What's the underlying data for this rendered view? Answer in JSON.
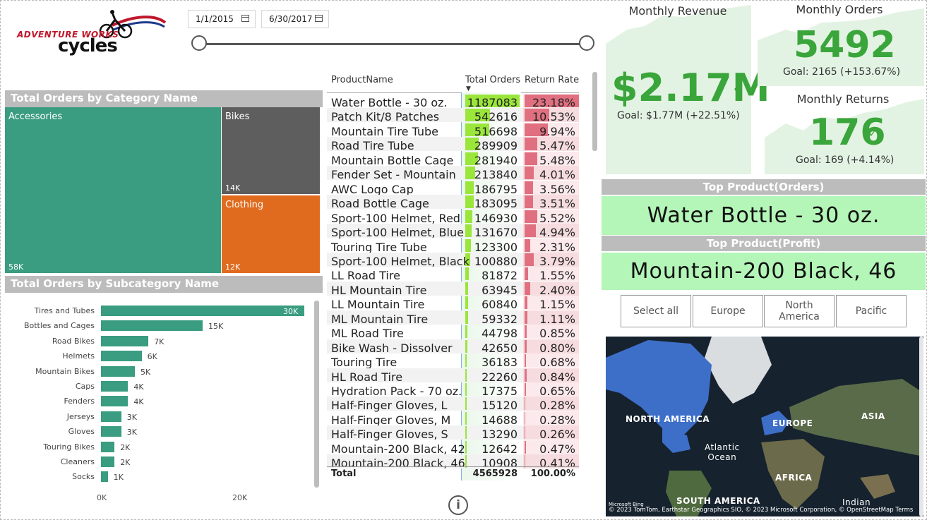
{
  "logo": {
    "line1": "ADVENTURE WORKS",
    "line2": "cycles"
  },
  "date_slicer": {
    "start": "1/1/2015",
    "end": "6/30/2017"
  },
  "category_treemap": {
    "title": "Total Orders by Category Name",
    "tiles": [
      {
        "name": "Accessories",
        "value": "58K",
        "color": "#3a9c80"
      },
      {
        "name": "Bikes",
        "value": "14K",
        "color": "#5e5e5e"
      },
      {
        "name": "Clothing",
        "value": "12K",
        "color": "#e06b1e"
      }
    ]
  },
  "chart_data": {
    "type": "bar",
    "title": "Total Orders by Subcategory Name",
    "categories": [
      "Tires and Tubes",
      "Bottles and Cages",
      "Road Bikes",
      "Helmets",
      "Mountain Bikes",
      "Caps",
      "Fenders",
      "Jerseys",
      "Gloves",
      "Touring Bikes",
      "Cleaners",
      "Socks"
    ],
    "values": [
      30000,
      15000,
      7000,
      6000,
      5000,
      4000,
      4000,
      3000,
      3000,
      2000,
      2000,
      1000
    ],
    "value_labels": [
      "30K",
      "15K",
      "7K",
      "6K",
      "5K",
      "4K",
      "4K",
      "3K",
      "3K",
      "2K",
      "2K",
      "1K"
    ],
    "x_ticks": [
      "0K",
      "20K"
    ],
    "xlim": [
      0,
      30000
    ],
    "color": "#3a9c80"
  },
  "product_table": {
    "headers": {
      "name": "ProductName",
      "orders": "Total Orders",
      "returns": "Return Rate"
    },
    "rows": [
      {
        "name": "Water Bottle - 30 oz.",
        "orders": "1187083",
        "rate": "23.18%",
        "o": 1187083,
        "r": 23.18
      },
      {
        "name": "Patch Kit/8 Patches",
        "orders": "542616",
        "rate": "10.53%",
        "o": 542616,
        "r": 10.53
      },
      {
        "name": "Mountain Tire Tube",
        "orders": "516698",
        "rate": "9.94%",
        "o": 516698,
        "r": 9.94
      },
      {
        "name": "Road Tire Tube",
        "orders": "289909",
        "rate": "5.47%",
        "o": 289909,
        "r": 5.47
      },
      {
        "name": "Mountain Bottle Cage",
        "orders": "281940",
        "rate": "5.48%",
        "o": 281940,
        "r": 5.48
      },
      {
        "name": "Fender Set - Mountain",
        "orders": "213840",
        "rate": "4.01%",
        "o": 213840,
        "r": 4.01
      },
      {
        "name": "AWC Logo Cap",
        "orders": "186795",
        "rate": "3.56%",
        "o": 186795,
        "r": 3.56
      },
      {
        "name": "Road Bottle Cage",
        "orders": "183095",
        "rate": "3.51%",
        "o": 183095,
        "r": 3.51
      },
      {
        "name": "Sport-100 Helmet, Red",
        "orders": "146930",
        "rate": "5.52%",
        "o": 146930,
        "r": 5.52
      },
      {
        "name": "Sport-100 Helmet, Blue",
        "orders": "131670",
        "rate": "4.94%",
        "o": 131670,
        "r": 4.94
      },
      {
        "name": "Touring Tire Tube",
        "orders": "123300",
        "rate": "2.31%",
        "o": 123300,
        "r": 2.31
      },
      {
        "name": "Sport-100 Helmet, Black",
        "orders": "100880",
        "rate": "3.79%",
        "o": 100880,
        "r": 3.79
      },
      {
        "name": "LL Road Tire",
        "orders": "81872",
        "rate": "1.55%",
        "o": 81872,
        "r": 1.55
      },
      {
        "name": "HL Mountain Tire",
        "orders": "63945",
        "rate": "2.40%",
        "o": 63945,
        "r": 2.4
      },
      {
        "name": "LL Mountain Tire",
        "orders": "60840",
        "rate": "1.15%",
        "o": 60840,
        "r": 1.15
      },
      {
        "name": "ML Mountain Tire",
        "orders": "59332",
        "rate": "1.11%",
        "o": 59332,
        "r": 1.11
      },
      {
        "name": "ML Road Tire",
        "orders": "44798",
        "rate": "0.85%",
        "o": 44798,
        "r": 0.85
      },
      {
        "name": "Bike Wash - Dissolver",
        "orders": "42650",
        "rate": "0.80%",
        "o": 42650,
        "r": 0.8
      },
      {
        "name": "Touring Tire",
        "orders": "36183",
        "rate": "0.68%",
        "o": 36183,
        "r": 0.68
      },
      {
        "name": "HL Road Tire",
        "orders": "22260",
        "rate": "0.84%",
        "o": 22260,
        "r": 0.84
      },
      {
        "name": "Hydration Pack - 70 oz.",
        "orders": "17375",
        "rate": "0.65%",
        "o": 17375,
        "r": 0.65
      },
      {
        "name": "Half-Finger Gloves, L",
        "orders": "15120",
        "rate": "0.28%",
        "o": 15120,
        "r": 0.28
      },
      {
        "name": "Half-Finger Gloves, M",
        "orders": "14688",
        "rate": "0.28%",
        "o": 14688,
        "r": 0.28
      },
      {
        "name": "Half-Finger Gloves, S",
        "orders": "13290",
        "rate": "0.26%",
        "o": 13290,
        "r": 0.26
      },
      {
        "name": "Mountain-200 Black, 42",
        "orders": "12642",
        "rate": "0.47%",
        "o": 12642,
        "r": 0.47
      },
      {
        "name": "Mountain-200 Black, 46",
        "orders": "10908",
        "rate": "0.41%",
        "o": 10908,
        "r": 0.41
      }
    ],
    "total": {
      "label": "Total",
      "orders": "4565928",
      "rate": "100.00%"
    }
  },
  "kpis": {
    "revenue": {
      "title": "Monthly Revenue",
      "value": "$2.17M",
      "goal": "Goal: $1.77M (+22.51%)"
    },
    "orders": {
      "title": "Monthly Orders",
      "value": "5492",
      "goal": "Goal: 2165 (+153.67%)"
    },
    "returns": {
      "title": "Monthly Returns",
      "value": "176",
      "goal": "Goal: 169 (+4.14%)"
    },
    "check_mark": "✓"
  },
  "top_product_orders": {
    "title": "Top Product(Orders)",
    "value": "Water Bottle - 30 oz."
  },
  "top_product_profit": {
    "title": "Top Product(Profit)",
    "value": "Mountain-200 Black, 46"
  },
  "region_slicer": [
    "Select all",
    "Europe",
    "North America",
    "Pacific"
  ],
  "map": {
    "labels": [
      "NORTH AMERICA",
      "EUROPE",
      "ASIA",
      "Atlantic\nOcean",
      "AFRICA",
      "SOUTH AMERICA",
      "Indian"
    ],
    "attribution": "© 2023 TomTom, Earthstar Geographics SIO, © 2023 Microsoft Corporation, © OpenStreetMap  Terms",
    "brand": "Microsoft Bing"
  },
  "info_icon": "i"
}
